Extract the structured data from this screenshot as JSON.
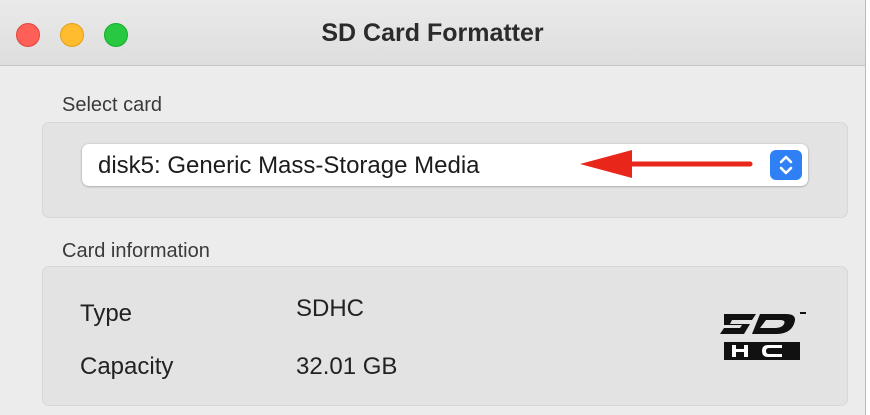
{
  "window": {
    "title": "SD Card Formatter"
  },
  "select_card": {
    "label": "Select card",
    "selected_value": "disk5: Generic Mass-Storage Media"
  },
  "card_information": {
    "label": "Card information",
    "rows": [
      {
        "label": "Type",
        "value": "SDHC"
      },
      {
        "label": "Capacity",
        "value": "32.01 GB"
      }
    ]
  },
  "icons": {
    "window_controls": [
      "close-button-icon",
      "minimize-button-icon",
      "zoom-button-icon"
    ],
    "popup_stepper": "up-down-chevron-icon",
    "annotation": "red-arrow-icon",
    "logo": "sdhc-logo"
  },
  "colors": {
    "accent_blue": "#2f7ff5",
    "annotation_red": "#e8261a",
    "close": "#fe5f57",
    "minimize": "#febc2e",
    "zoom": "#28c840"
  }
}
